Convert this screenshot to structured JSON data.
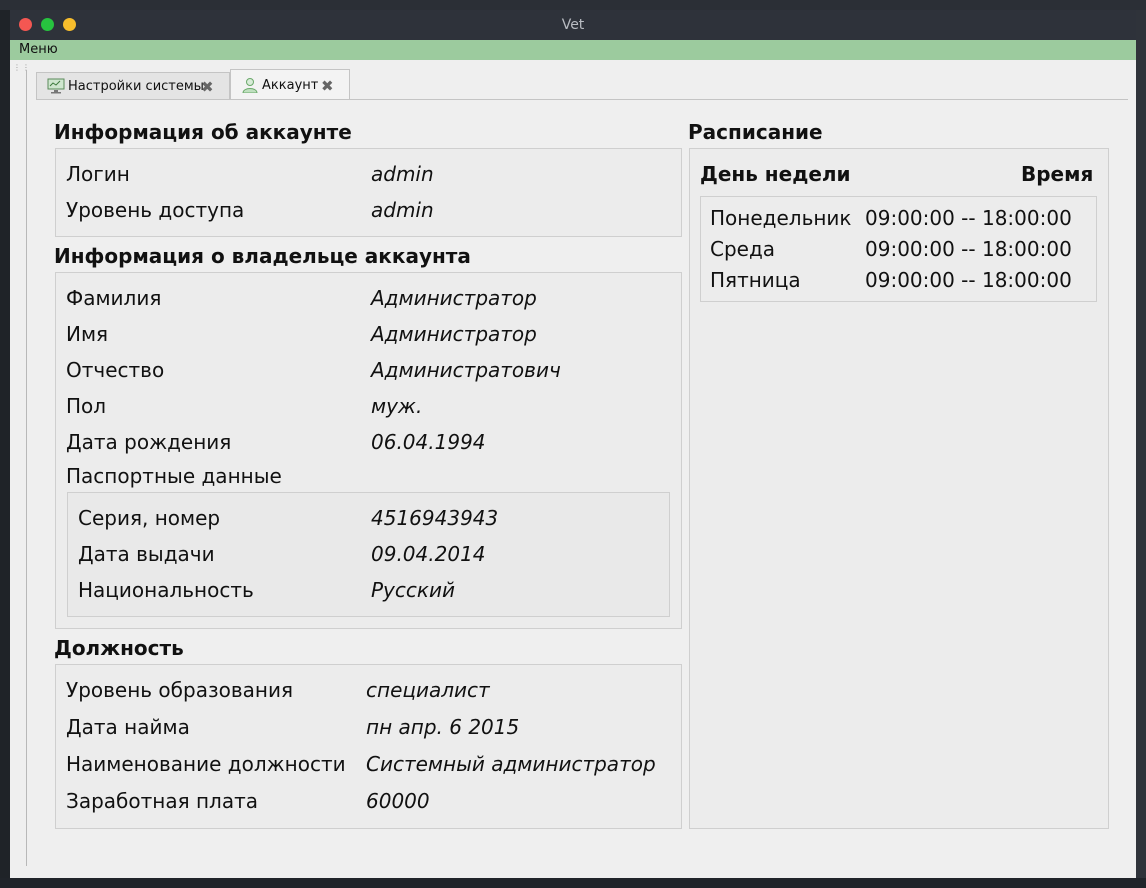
{
  "window": {
    "title": "Vet"
  },
  "menubar": {
    "menu_label": "Меню"
  },
  "tabs": [
    {
      "label": "Настройки системы",
      "icon": "monitor-icon"
    },
    {
      "label": "Аккаунт",
      "icon": "user-icon"
    }
  ],
  "account": {
    "heading": "Информация об аккаунте",
    "rows": [
      {
        "label": "Логин",
        "value": "admin"
      },
      {
        "label": "Уровень доступа",
        "value": "admin"
      }
    ]
  },
  "owner": {
    "heading": "Информация о владельце аккаунта",
    "rows": [
      {
        "label": "Фамилия",
        "value": "Администратор"
      },
      {
        "label": "Имя",
        "value": "Администратор"
      },
      {
        "label": "Отчество",
        "value": "Администратович"
      },
      {
        "label": "Пол",
        "value": "муж."
      },
      {
        "label": "Дата рождения",
        "value": "06.04.1994"
      }
    ],
    "passport_label": "Паспортные данные",
    "passport": [
      {
        "label": "Серия, номер",
        "value": "4516943943"
      },
      {
        "label": "Дата выдачи",
        "value": "09.04.2014"
      },
      {
        "label": "Национальность",
        "value": "Русский"
      }
    ]
  },
  "position": {
    "heading": "Должность",
    "rows": [
      {
        "label": "Уровень образования",
        "value": "специалист"
      },
      {
        "label": "Дата найма",
        "value": "пн апр. 6 2015"
      },
      {
        "label": "Наименование должности",
        "value": "Системный администратор"
      },
      {
        "label": "Заработная плата",
        "value": "60000"
      }
    ]
  },
  "schedule": {
    "heading": "Расписание",
    "col_day": "День недели",
    "col_time": "Время",
    "rows": [
      {
        "day": "Понедельник",
        "time": "09:00:00 -- 18:00:00"
      },
      {
        "day": "Среда",
        "time": "09:00:00 -- 18:00:00"
      },
      {
        "day": "Пятница",
        "time": "09:00:00 -- 18:00:00"
      }
    ]
  }
}
